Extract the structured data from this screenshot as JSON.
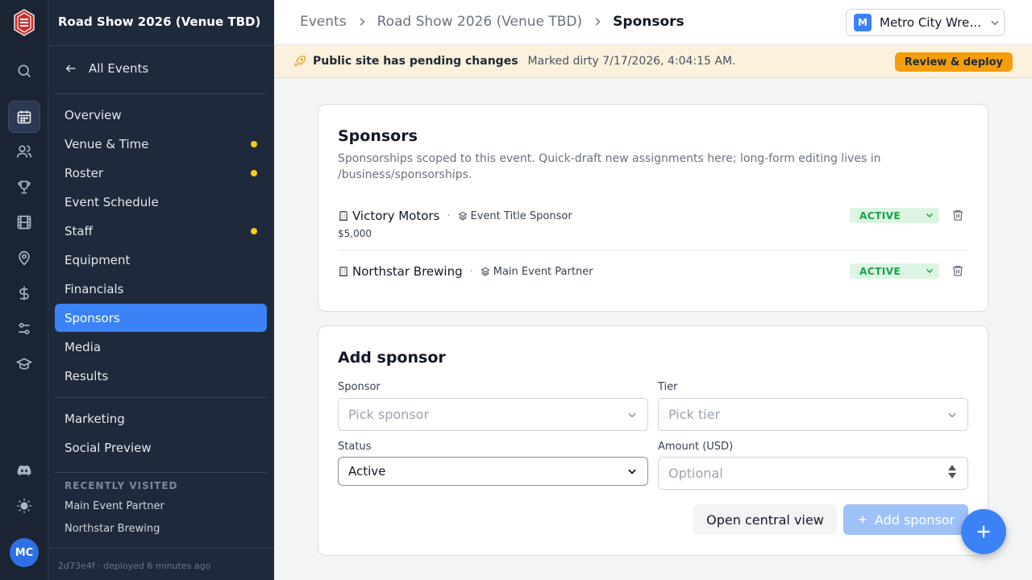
{
  "app": {
    "initials": "MC",
    "build": "2d73e4f · deployed 6 minutes ago"
  },
  "rail": [
    "logo-icon",
    "search-icon",
    "calendar-icon",
    "users-icon",
    "trophy-icon",
    "film-icon",
    "map-pin-icon",
    "dollar-icon",
    "sliders-icon",
    "graduation-cap-icon",
    "discord-icon",
    "sun-icon"
  ],
  "sidebar": {
    "event_title": "Road Show 2026 (Venue TBD)",
    "back_label": "All Events",
    "items": [
      {
        "label": "Overview"
      },
      {
        "label": "Venue & Time",
        "dirty": true
      },
      {
        "label": "Roster",
        "dirty": true
      },
      {
        "label": "Event Schedule"
      },
      {
        "label": "Staff",
        "dirty": true
      },
      {
        "label": "Equipment"
      },
      {
        "label": "Financials"
      },
      {
        "label": "Sponsors",
        "active": true
      },
      {
        "label": "Media"
      },
      {
        "label": "Results"
      },
      {
        "label": "Marketing"
      },
      {
        "label": "Social Preview"
      }
    ],
    "recent_heading": "RECENTLY VISITED",
    "recent": [
      "Main Event Partner",
      "Northstar Brewing"
    ]
  },
  "breadcrumb": [
    "Events",
    "Road Show 2026 (Venue TBD)",
    "Sponsors"
  ],
  "org": {
    "badge": "M",
    "name": "Metro City Wrestling"
  },
  "banner": {
    "message": "Public site has pending changes",
    "timestamp": "Marked dirty 7/17/2026, 4:04:15 AM.",
    "action": "Review & deploy"
  },
  "sponsors_card": {
    "title": "Sponsors",
    "description": "Sponsorships scoped to this event. Quick-draft new assignments here; long-form editing lives in /business/sponsorships.",
    "rows": [
      {
        "name": "Victory Motors",
        "tier": "Event Title Sponsor",
        "amount": "$5,000",
        "status": "ACTIVE"
      },
      {
        "name": "Northstar Brewing",
        "tier": "Main Event Partner",
        "amount": "",
        "status": "ACTIVE"
      }
    ],
    "separator": "·"
  },
  "add_card": {
    "title": "Add sponsor",
    "sponsor_label": "Sponsor",
    "sponsor_placeholder": "Pick sponsor",
    "tier_label": "Tier",
    "tier_placeholder": "Pick tier",
    "status_label": "Status",
    "status_value": "Active",
    "amount_label": "Amount (USD)",
    "amount_placeholder": "Optional",
    "open_central_label": "Open central view",
    "add_label": "Add sponsor"
  },
  "colors": {
    "accent": "#3b82f6",
    "warning": "#f59e0b",
    "success": "#16a34a",
    "nav_bg": "#1e293b",
    "rail_bg": "#1b2433"
  }
}
